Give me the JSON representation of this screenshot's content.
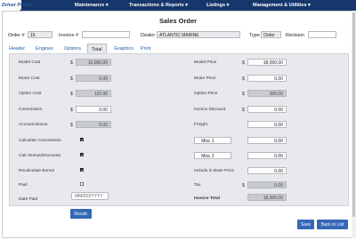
{
  "brand": {
    "logo": "Driver Pointe"
  },
  "menu": [
    "Maintenance ▾",
    "Transactions & Reports ▾",
    "Listings ▾",
    "Management & Utilities ▾"
  ],
  "page_title": "Sales Order",
  "header": {
    "order_label": "Order #",
    "order_value": "16",
    "invoice_label": "Invoice #",
    "invoice_value": "",
    "dealer_label": "Dealer",
    "dealer_value": "ATLANTIC MARINE",
    "type_label": "Type",
    "type_value": "Order",
    "revision_label": "Revision",
    "revision_value": ""
  },
  "tabs": [
    "Header",
    "Engines",
    "Options",
    "Total",
    "Graphics",
    "Print"
  ],
  "active_tab": "Total",
  "left": {
    "model_cost": {
      "label": "Model Cost",
      "value": "10,000.00"
    },
    "motor_cost": {
      "label": "Motor Cost",
      "value": "0.00"
    },
    "option_cost": {
      "label": "Option Cost",
      "value": "110.00"
    },
    "commission": {
      "label": "Commission",
      "value": "0.00"
    },
    "accrued_bonus": {
      "label": "Accrued Bonus",
      "value": "0.00"
    },
    "calculate_commission": {
      "label": "Calculate Commission",
      "checked": true
    },
    "calc_bonus": {
      "label": "Calc Bonus/Discounts",
      "checked": true
    },
    "recalculate_bonus": {
      "label": "Recalculate Bonus",
      "checked": true
    },
    "paid": {
      "label": "Paid",
      "checked": false
    },
    "date_paid": {
      "label": "Date Paid",
      "placeholder": "MM/DD/YYYY"
    },
    "recalc_button": "Recalc"
  },
  "right": {
    "model_price": {
      "label": "Model Price",
      "value": "18,000.00"
    },
    "motor_price": {
      "label": "Motor Price",
      "value": "0.00"
    },
    "option_price": {
      "label": "Option Price",
      "value": "300.00"
    },
    "invoice_discount": {
      "label": "Invoice Discount",
      "value": "0.00"
    },
    "freight": {
      "label": "Freight",
      "value": "0.00"
    },
    "misc1": {
      "label": "Misc 1",
      "value": "0.00"
    },
    "misc2": {
      "label": "Misc 2",
      "value": "0.00"
    },
    "include_base": {
      "label": "Include in Base Price",
      "value": "0.00"
    },
    "tax": {
      "label": "Tax",
      "value": "0.00"
    },
    "invoice_total": {
      "label": "Invoice Total",
      "value": "18,300.00"
    }
  },
  "currency_symbol": "$",
  "check_glyph": "✔",
  "buttons": {
    "save": "Save",
    "back": "Back to List"
  }
}
